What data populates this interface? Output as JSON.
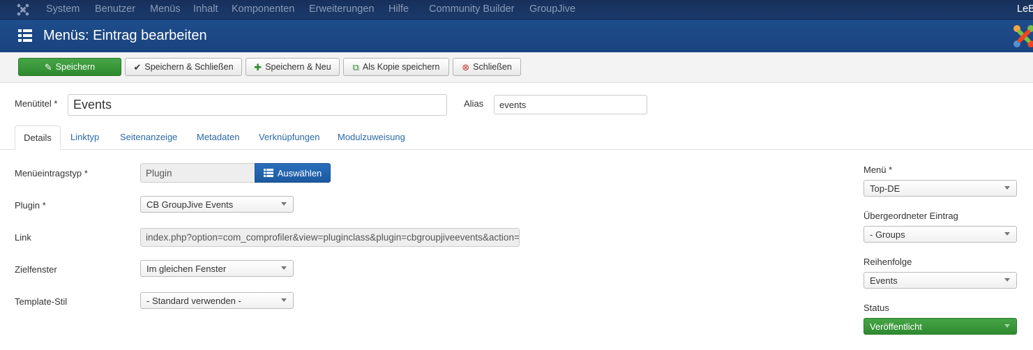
{
  "topnav": {
    "items": [
      "System",
      "Benutzer",
      "Menüs",
      "Inhalt",
      "Komponenten",
      "Erweiterungen",
      "Hilfe",
      "Community Builder",
      "GroupJive"
    ],
    "user": "LeB"
  },
  "header": {
    "title": "Menüs: Eintrag bearbeiten"
  },
  "toolbar": {
    "save": "Speichern",
    "save_close": "Speichern & Schließen",
    "save_new": "Speichern & Neu",
    "save_copy": "Als Kopie speichern",
    "close": "Schließen"
  },
  "form": {
    "menu_title_label": "Menütitel *",
    "menu_title_value": "Events",
    "alias_label": "Alias",
    "alias_value": "events"
  },
  "tabs": [
    "Details",
    "Linktyp",
    "Seitenanzeige",
    "Metadaten",
    "Verknüpfungen",
    "Modulzuweisung"
  ],
  "details": {
    "type_label": "Menüeintragstyp *",
    "type_value": "Plugin",
    "choose_button": "Auswählen",
    "plugin_label": "Plugin *",
    "plugin_value": "CB GroupJive Events",
    "link_label": "Link",
    "link_value": "index.php?option=com_comprofiler&view=pluginclass&plugin=cbgroupjiveevents&action=allc",
    "target_label": "Zielfenster",
    "target_value": "Im gleichen Fenster",
    "template_label": "Template-Stil",
    "template_value": "- Standard verwenden -"
  },
  "sidebar": {
    "menu_label": "Menü *",
    "menu_value": "Top-DE",
    "parent_label": "Übergeordneter Eintrag",
    "parent_value": "- Groups",
    "order_label": "Reihenfolge",
    "order_value": "Events",
    "status_label": "Status",
    "status_value": "Veröffentlicht"
  },
  "colors": {
    "topnav_bg": "#1b3a6b",
    "titlebar_bg": "#1d4a86",
    "success": "#3a993a",
    "primary": "#1c5aa0",
    "link": "#2a69a8"
  },
  "icons": {
    "joomla_logo": "joomla-icon",
    "menu": "list-icon",
    "save": "edit-icon",
    "save_close": "check-icon",
    "save_new": "plus-icon",
    "save_copy": "copy-icon",
    "close": "cancel-circle-icon",
    "choose": "list-icon"
  }
}
